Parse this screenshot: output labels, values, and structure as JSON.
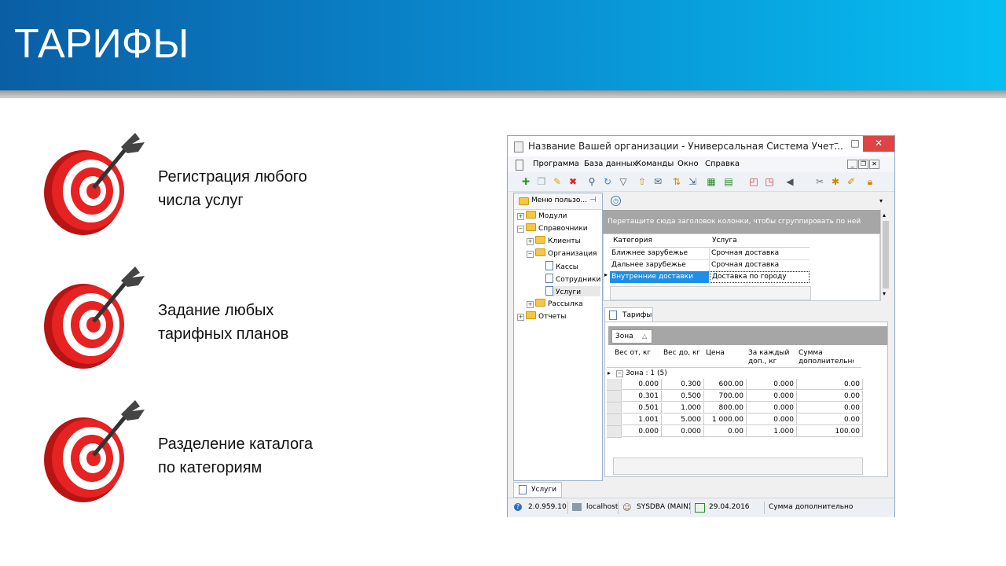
{
  "slide": {
    "title": "ТАРИФЫ",
    "features": [
      {
        "line1": "Регистрация любого",
        "line2": "числа услуг"
      },
      {
        "line1": "Задание любых",
        "line2": "тарифных планов"
      },
      {
        "line1": "Разделение каталога",
        "line2": "по категориям"
      }
    ]
  },
  "window": {
    "title": "Название Вашей организации - Универсальная Система Учет...",
    "menu": [
      "Программа",
      "База данных",
      "Команды",
      "Окно",
      "Справка"
    ],
    "left_pane_title": "Меню пользо...",
    "tree": [
      "Модули",
      "Справочники",
      "Клиенты",
      "Организация",
      "Кассы",
      "Сотрудники",
      "Услуги",
      "Рассылка",
      "Отчеты"
    ],
    "group_hint": "Перетащите сюда заголовок колонки, чтобы сгруппировать по ней",
    "services_grid": {
      "columns": [
        "Категория",
        "Услуга"
      ],
      "rows": [
        [
          "Ближнее зарубежье",
          "Срочная доставка"
        ],
        [
          "Дальнее зарубежье",
          "Срочная доставка"
        ],
        [
          "Внутренние доставки",
          "Доставка по городу"
        ]
      ]
    },
    "tab_label": "Тарифы",
    "group_chip": "Зона",
    "tariff_grid": {
      "columns": [
        "Вес от, кг",
        "Вес до, кг",
        "Цена",
        "За каждый доп., кг",
        "Сумма дополнительно"
      ],
      "group_row": "Зона : 1 (5)",
      "rows": [
        [
          "0.000",
          "0.300",
          "600.00",
          "0.000",
          "0.00"
        ],
        [
          "0.301",
          "0.500",
          "700.00",
          "0.000",
          "0.00"
        ],
        [
          "0.501",
          "1.000",
          "800.00",
          "0.000",
          "0.00"
        ],
        [
          "1.001",
          "5.000",
          "1 000.00",
          "0.000",
          "0.00"
        ],
        [
          "0.000",
          "0.000",
          "0.00",
          "1.000",
          "100.00"
        ]
      ]
    },
    "bottom_tab": "Услуги",
    "status": {
      "version": "2.0.959.10",
      "host": "localhost",
      "user": "SYSDBA (MAIN)",
      "date": "29.04.2016",
      "field": "Сумма дополнительно"
    },
    "colors": {
      "selection": "#1e8ee8",
      "header_blue": "#0a86cc"
    }
  }
}
